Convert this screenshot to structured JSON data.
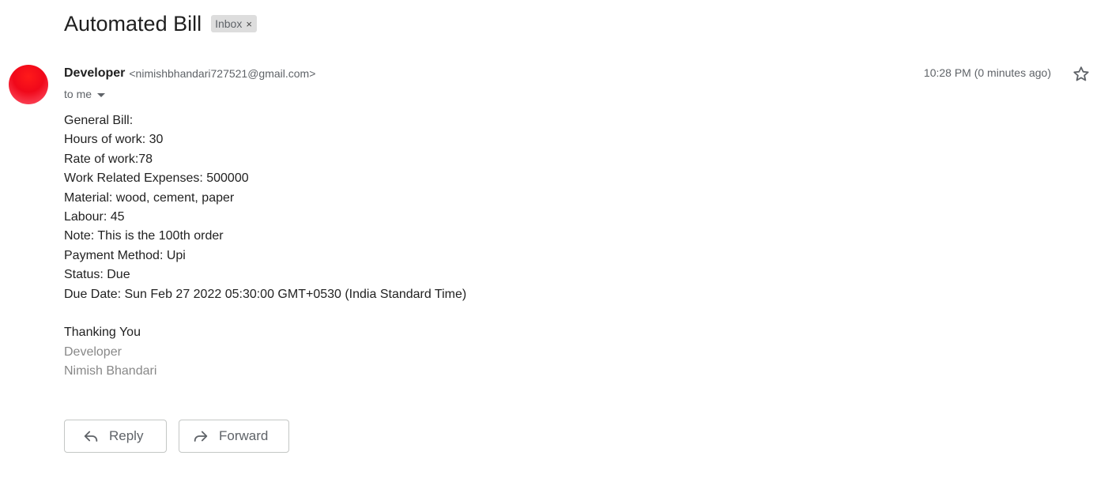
{
  "email": {
    "subject": "Automated Bill",
    "label": "Inbox",
    "label_close": "×",
    "sender_name": "Developer",
    "sender_email": "<nimishbhandari727521@gmail.com>",
    "to_line": "to me",
    "timestamp": "10:28 PM (0 minutes ago)",
    "body_lines": [
      "General Bill:",
      "Hours of work: 30",
      "Rate of work:78",
      "Work Related Expenses: 500000",
      "Material: wood, cement, paper",
      "Labour: 45",
      "Note: This is the 100th order",
      "Payment Method: Upi",
      "Status: Due",
      "Due Date: Sun Feb 27 2022 05:30:00 GMT+0530 (India Standard Time)"
    ],
    "closing": "Thanking You",
    "signature_lines": [
      "Developer",
      "Nimish Bhandari"
    ]
  },
  "actions": {
    "reply_label": "Reply",
    "forward_label": "Forward"
  },
  "icons": {
    "star": "star-outline-icon",
    "reply": "reply-arrow-icon",
    "forward": "forward-arrow-icon",
    "dropdown": "caret-down-icon"
  },
  "colors": {
    "avatar": "#f0081a",
    "chip_bg": "#dddddd",
    "muted_text": "#5f6368",
    "signature_text": "#888888"
  }
}
